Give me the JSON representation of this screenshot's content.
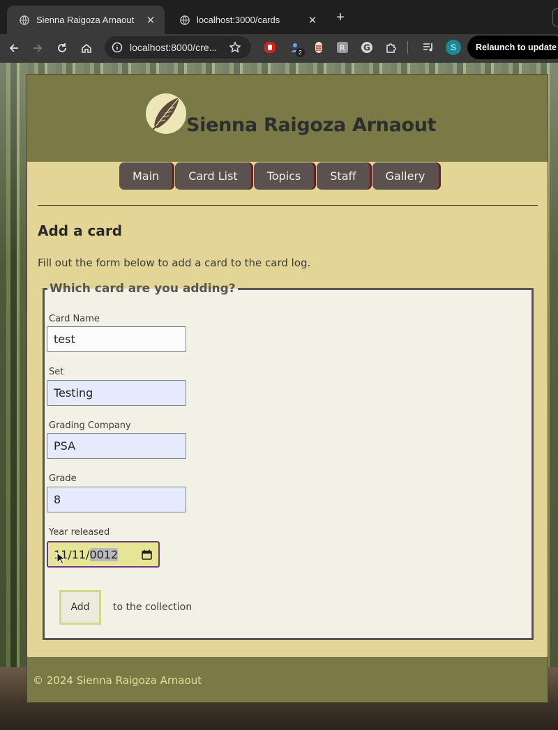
{
  "browser": {
    "tabs": [
      {
        "title": "Sienna Raigoza Arnaout",
        "active": true
      },
      {
        "title": "localhost:3000/cards",
        "active": false
      }
    ],
    "url": "localhost:8000/cre...",
    "profile_initial": "S",
    "extension_badge": "2",
    "relaunch_label": "Relaunch to update"
  },
  "site": {
    "title": "Sienna Raigoza Arnaout",
    "nav": [
      "Main",
      "Card List",
      "Topics",
      "Staff",
      "Gallery"
    ],
    "footer": "© 2024 Sienna Raigoza Arnaout"
  },
  "page": {
    "heading": "Add a card",
    "intro": "Fill out the form below to add a card to the card log.",
    "form": {
      "legend": "Which card are you adding?",
      "card_name": {
        "label": "Card Name",
        "value": "test"
      },
      "set": {
        "label": "Set",
        "value": "Testing"
      },
      "grading_company": {
        "label": "Grading Company",
        "value": "PSA"
      },
      "grade": {
        "label": "Grade",
        "value": "8"
      },
      "year_released": {
        "label": "Year released",
        "month": "11",
        "day": "11",
        "year": "0012"
      },
      "submit_label": "Add",
      "submit_note": "to the collection"
    }
  },
  "colors": {
    "header": "#7a7a47",
    "page_bg": "#e2d596",
    "nav_button": "#5b514e",
    "fieldset_bg": "#f1f1e5",
    "autofill_bg": "#e3ebfd",
    "date_bg": "#e6e596"
  }
}
